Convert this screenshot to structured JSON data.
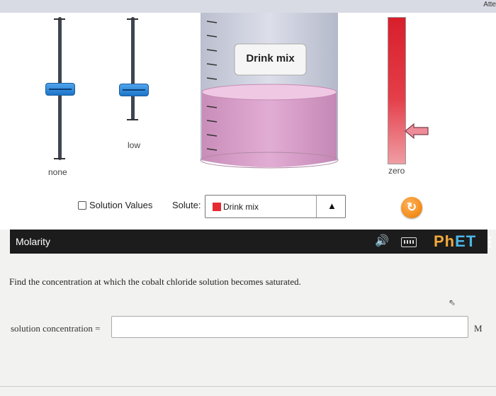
{
  "header": {
    "attempt_label": "Atte"
  },
  "sliders": {
    "left_label": "none",
    "right_label": "low"
  },
  "beaker": {
    "label": "Drink mix"
  },
  "concentration_meter": {
    "label": "zero"
  },
  "controls": {
    "checkbox_label": "Solution Values",
    "solute_label": "Solute:",
    "solute_value": "Drink mix",
    "solute_color": "#e62a32"
  },
  "navbar": {
    "title": "Molarity",
    "logo_ph": "PhET",
    "menu_icon": "vertical-ellipsis-icon"
  },
  "question": {
    "text": "Find the concentration at which the cobalt chloride solution becomes saturated.",
    "answer_label": "solution concentration =",
    "answer_value": "",
    "answer_unit": "M"
  }
}
